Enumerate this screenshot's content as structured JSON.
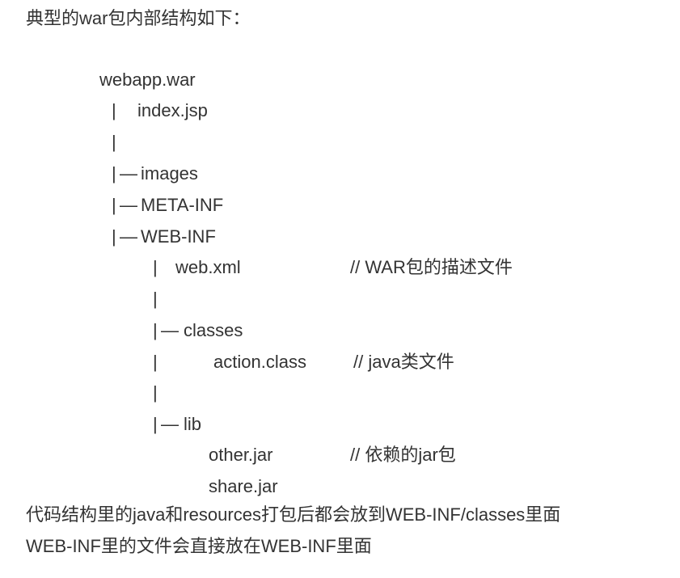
{
  "intro": "典型的war包内部结构如下：",
  "tree": {
    "root": "webapp.war",
    "pipe": "|",
    "dash": "—",
    "index_jsp": "index.jsp",
    "images": "images",
    "meta_inf": "META-INF",
    "web_inf": "WEB-INF",
    "web_xml": "web.xml",
    "web_xml_comment": "// WAR包的描述文件",
    "classes": "classes",
    "action_class": "action.class",
    "action_class_comment": "// java类文件",
    "lib": "lib",
    "other_jar": "other.jar",
    "other_jar_comment": "// 依赖的jar包",
    "share_jar": "share.jar"
  },
  "para1": "代码结构里的java和resources打包后都会放到WEB-INF/classes里面",
  "para2": "WEB-INF里的文件会直接放在WEB-INF里面"
}
